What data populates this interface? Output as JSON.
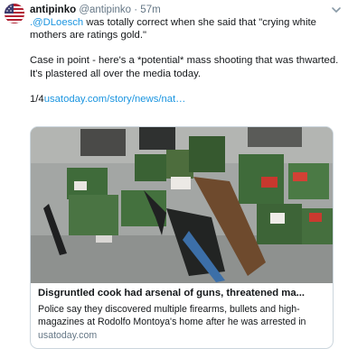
{
  "tweet": {
    "display_name": "antipinko",
    "handle": "@antipinko",
    "separator": "·",
    "time": "57m",
    "line1_mention": ".@DLoesch",
    "line1_rest": " was totally correct when she said that \"crying white",
    "line2": "mothers are ratings gold.\"",
    "line3": "Case in point - here's a *potential* mass shooting that was thwarted.",
    "line4": "It's plastered all over the media today.",
    "thread_count": "1/4",
    "link": "usatoday.com/story/news/nat…"
  },
  "card": {
    "title": "Disgruntled cook had arsenal of guns, threatened ma...",
    "description_line1": "Police say they discovered multiple firearms, bullets and high-",
    "description_line2": "magazines at Rodolfo Montoya's home after he was arrested in",
    "domain": "usatoday.com"
  },
  "colors": {
    "link": "#1b95e0",
    "muted": "#657786",
    "border": "#ccd6dd",
    "ammo_box": "#3f6b3a"
  },
  "icons": {
    "menu": "chevron-down-icon",
    "avatar": "american-flag-avatar"
  }
}
